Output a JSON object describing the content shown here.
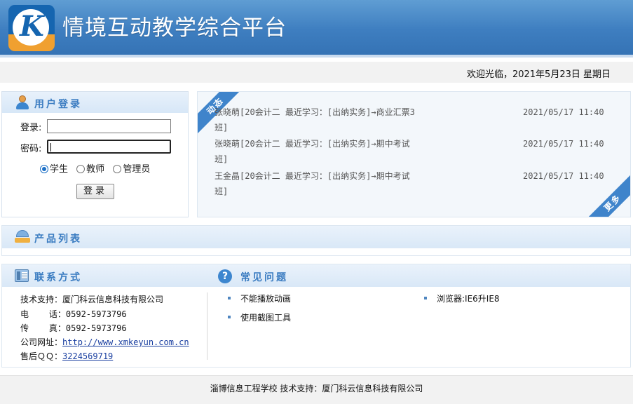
{
  "header": {
    "logo_letter": "K",
    "title": "情境互动教学综合平台"
  },
  "welcome": {
    "text": "欢迎光临，2021年5月23日 星期日"
  },
  "login": {
    "title": "用户登录",
    "username_label": "登录:",
    "password_label": "密码:",
    "username_value": "",
    "password_value": "",
    "roles": [
      {
        "label": "学生",
        "checked": true
      },
      {
        "label": "教师",
        "checked": false
      },
      {
        "label": "管理员",
        "checked": false
      }
    ],
    "submit_label": "登录"
  },
  "activity": {
    "ribbon_top": "动态",
    "ribbon_bottom": "更多",
    "items": [
      {
        "line1": "张晓萌[20会计二 最近学习：[出纳实务]→商业汇票3",
        "line2": "班]",
        "time": "2021/05/17 11:40"
      },
      {
        "line1": "张晓萌[20会计二 最近学习：[出纳实务]→期中考试",
        "line2": "班]",
        "time": "2021/05/17 11:40"
      },
      {
        "line1": "王金晶[20会计二 最近学习：[出纳实务]→期中考试",
        "line2": "班]",
        "time": "2021/05/17 11:40"
      }
    ]
  },
  "products": {
    "title": "产品列表"
  },
  "contact": {
    "title": "联系方式",
    "support": "技术支持：厦门科云信息科技有限公司",
    "phone": "电    话：0592-5973796",
    "fax": "传    真：0592-5973796",
    "website_label": "公司网址：",
    "website": "http://www.xmkeyun.com.cn",
    "qq_label": "售后ＱＱ：",
    "qq": "3224569719"
  },
  "faq": {
    "title": "常见问题",
    "items": [
      "不能播放动画",
      "使用截图工具",
      "浏览器:IE6升IE8"
    ]
  },
  "footer": {
    "text": "淄博信息工程学校 技术支持：厦门科云信息科技有限公司"
  },
  "colors": {
    "header_blue": "#3e7ec0",
    "accent_blue": "#3a7cc1",
    "link_blue": "#1a3fa0"
  }
}
